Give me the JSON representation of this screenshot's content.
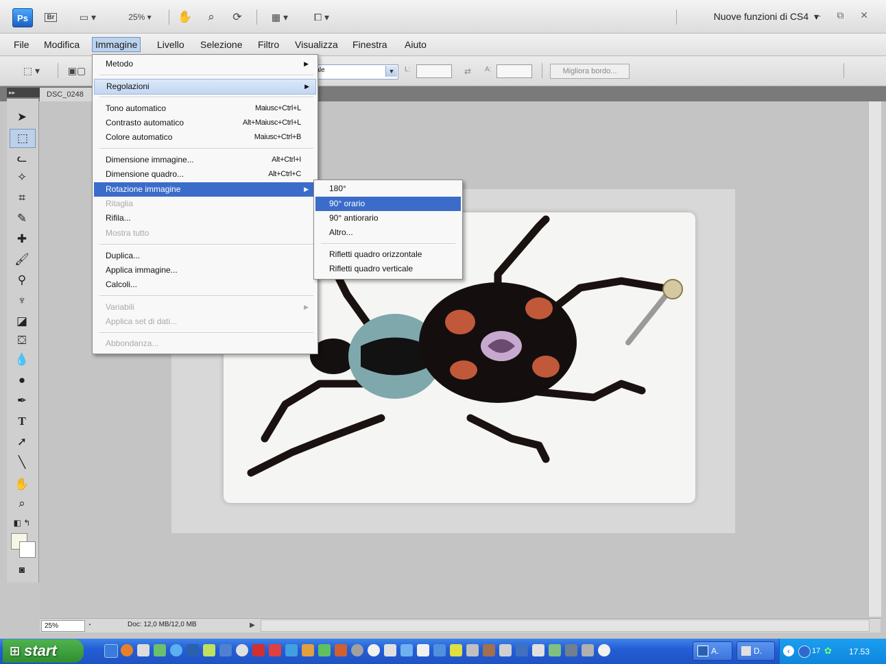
{
  "appbar": {
    "app_badge": "Ps",
    "bridge_badge": "Br",
    "zoom": "25%",
    "workspace": "Nuove funzioni di CS4",
    "workspace_arrow": "▾",
    "window_controls": "– ⧉ ✕"
  },
  "menubar": {
    "items": [
      "File",
      "Modifica",
      "Immagine",
      "Livello",
      "Selezione",
      "Filtro",
      "Visualizza",
      "Finestra",
      "Aiuto"
    ]
  },
  "options": {
    "style_value": "male",
    "width_label": "L:",
    "height_label": "A:",
    "refine_edge": "Migliora bordo..."
  },
  "document": {
    "tab_name": "DSC_0248",
    "zoom_field": "25%",
    "doc_info": "Doc: 12,0 MB/12,0 MB"
  },
  "image_menu": {
    "items": [
      {
        "label": "Metodo",
        "submenu": true
      },
      {
        "label": "Regolazioni",
        "submenu": true
      },
      {
        "label": "Tono automatico",
        "shortcut": "Maiusc+Ctrl+L"
      },
      {
        "label": "Contrasto automatico",
        "shortcut": "Alt+Maiusc+Ctrl+L"
      },
      {
        "label": "Colore automatico",
        "shortcut": "Maiusc+Ctrl+B"
      },
      {
        "label": "Dimensione immagine...",
        "shortcut": "Alt+Ctrl+I"
      },
      {
        "label": "Dimensione quadro...",
        "shortcut": "Alt+Ctrl+C"
      },
      {
        "label": "Rotazione immagine",
        "submenu": true
      },
      {
        "label": "Ritaglia"
      },
      {
        "label": "Rifila..."
      },
      {
        "label": "Mostra tutto"
      },
      {
        "label": "Duplica..."
      },
      {
        "label": "Applica immagine..."
      },
      {
        "label": "Calcoli..."
      },
      {
        "label": "Variabili",
        "submenu": true
      },
      {
        "label": "Applica set di dati..."
      },
      {
        "label": "Abbondanza..."
      }
    ]
  },
  "rotation_menu": {
    "items": [
      "180°",
      "90° orario",
      "90° antiorario",
      "Altro...",
      "Rifletti quadro orizzontale",
      "Rifletti quadro verticale"
    ]
  },
  "taskbar": {
    "start_label": "start",
    "task_a": "A.",
    "task_d": "D.",
    "tray_count": "17",
    "clock": "17.53"
  },
  "colors": {
    "menu_highlight": "#3b6cc9",
    "taskbar_blue": "#245ed6",
    "start_green": "#3a9a3a"
  }
}
